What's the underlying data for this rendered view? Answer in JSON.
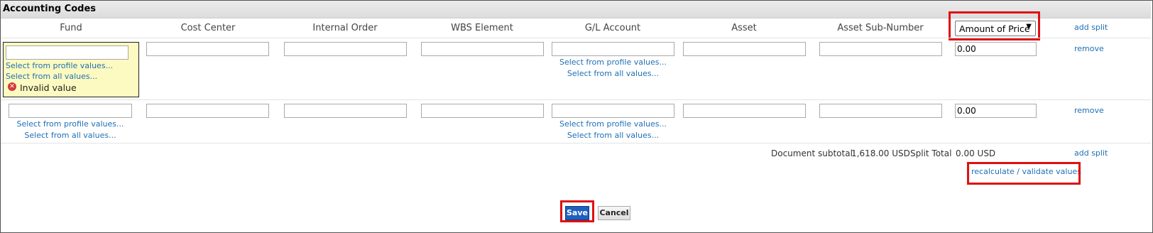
{
  "section_title": "Accounting Codes",
  "columns": [
    "Fund",
    "Cost Center",
    "Internal Order",
    "WBS Element",
    "G/L Account",
    "Asset",
    "Asset Sub-Number"
  ],
  "split_type": {
    "selected": "Amount of Price",
    "arrow": "▼"
  },
  "add_split": "add split",
  "remove": "remove",
  "links": {
    "profile": "Select from profile values...",
    "all": "Select from all values..."
  },
  "rows": [
    {
      "amount": "0.00",
      "fund_error": "Invalid value"
    },
    {
      "amount": "0.00"
    }
  ],
  "footer": {
    "document_subtotal_label": "Document subtotal:",
    "document_subtotal_value": "1,618.00 USD",
    "split_total_label": "Split Total",
    "split_total_value": "0.00 USD",
    "recalculate": "recalculate / validate values"
  },
  "buttons": {
    "save": "Save",
    "cancel": "Cancel"
  },
  "colors": {
    "link": "#1f6fb5",
    "highlight": "#e01010",
    "error_bg": "#fcfac0",
    "save_bg": "#1f5fbf"
  }
}
